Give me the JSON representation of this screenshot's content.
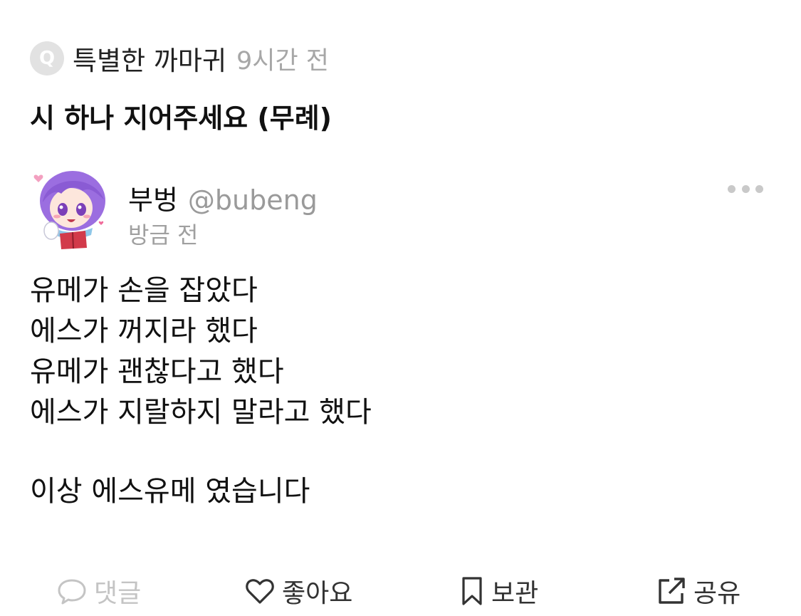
{
  "question": {
    "badge": "Q",
    "asker": "특별한 까마귀",
    "time": "9시간 전",
    "text": "시 하나 지어주세요 (무례)"
  },
  "answer": {
    "author_name": "부벙",
    "author_handle": "@bubeng",
    "time": "방금 전",
    "avatar_icon": "anime-avatar-purple-hair",
    "more_icon": "more-horizontal-icon",
    "lines_part1": [
      "유메가 손을 잡았다",
      "에스가 꺼지라 했다",
      "유메가 괜찮다고 했다",
      "에스가 지랄하지 말라고 했다"
    ],
    "lines_part2": [
      "이상 에스유메 였습니다"
    ]
  },
  "actions": {
    "comment": {
      "label": "댓글",
      "icon": "comment-bubble-icon",
      "disabled": true
    },
    "like": {
      "label": "좋아요",
      "icon": "heart-icon"
    },
    "save": {
      "label": "보관",
      "icon": "bookmark-icon"
    },
    "share": {
      "label": "공유",
      "icon": "share-external-icon"
    }
  },
  "colors": {
    "text": "#111111",
    "muted": "#9a9a9a",
    "badge": "#e2e2e2",
    "disabled": "#c4c4c4",
    "avatar_hair": "#9b6ee0",
    "book": "#d23a4a"
  }
}
